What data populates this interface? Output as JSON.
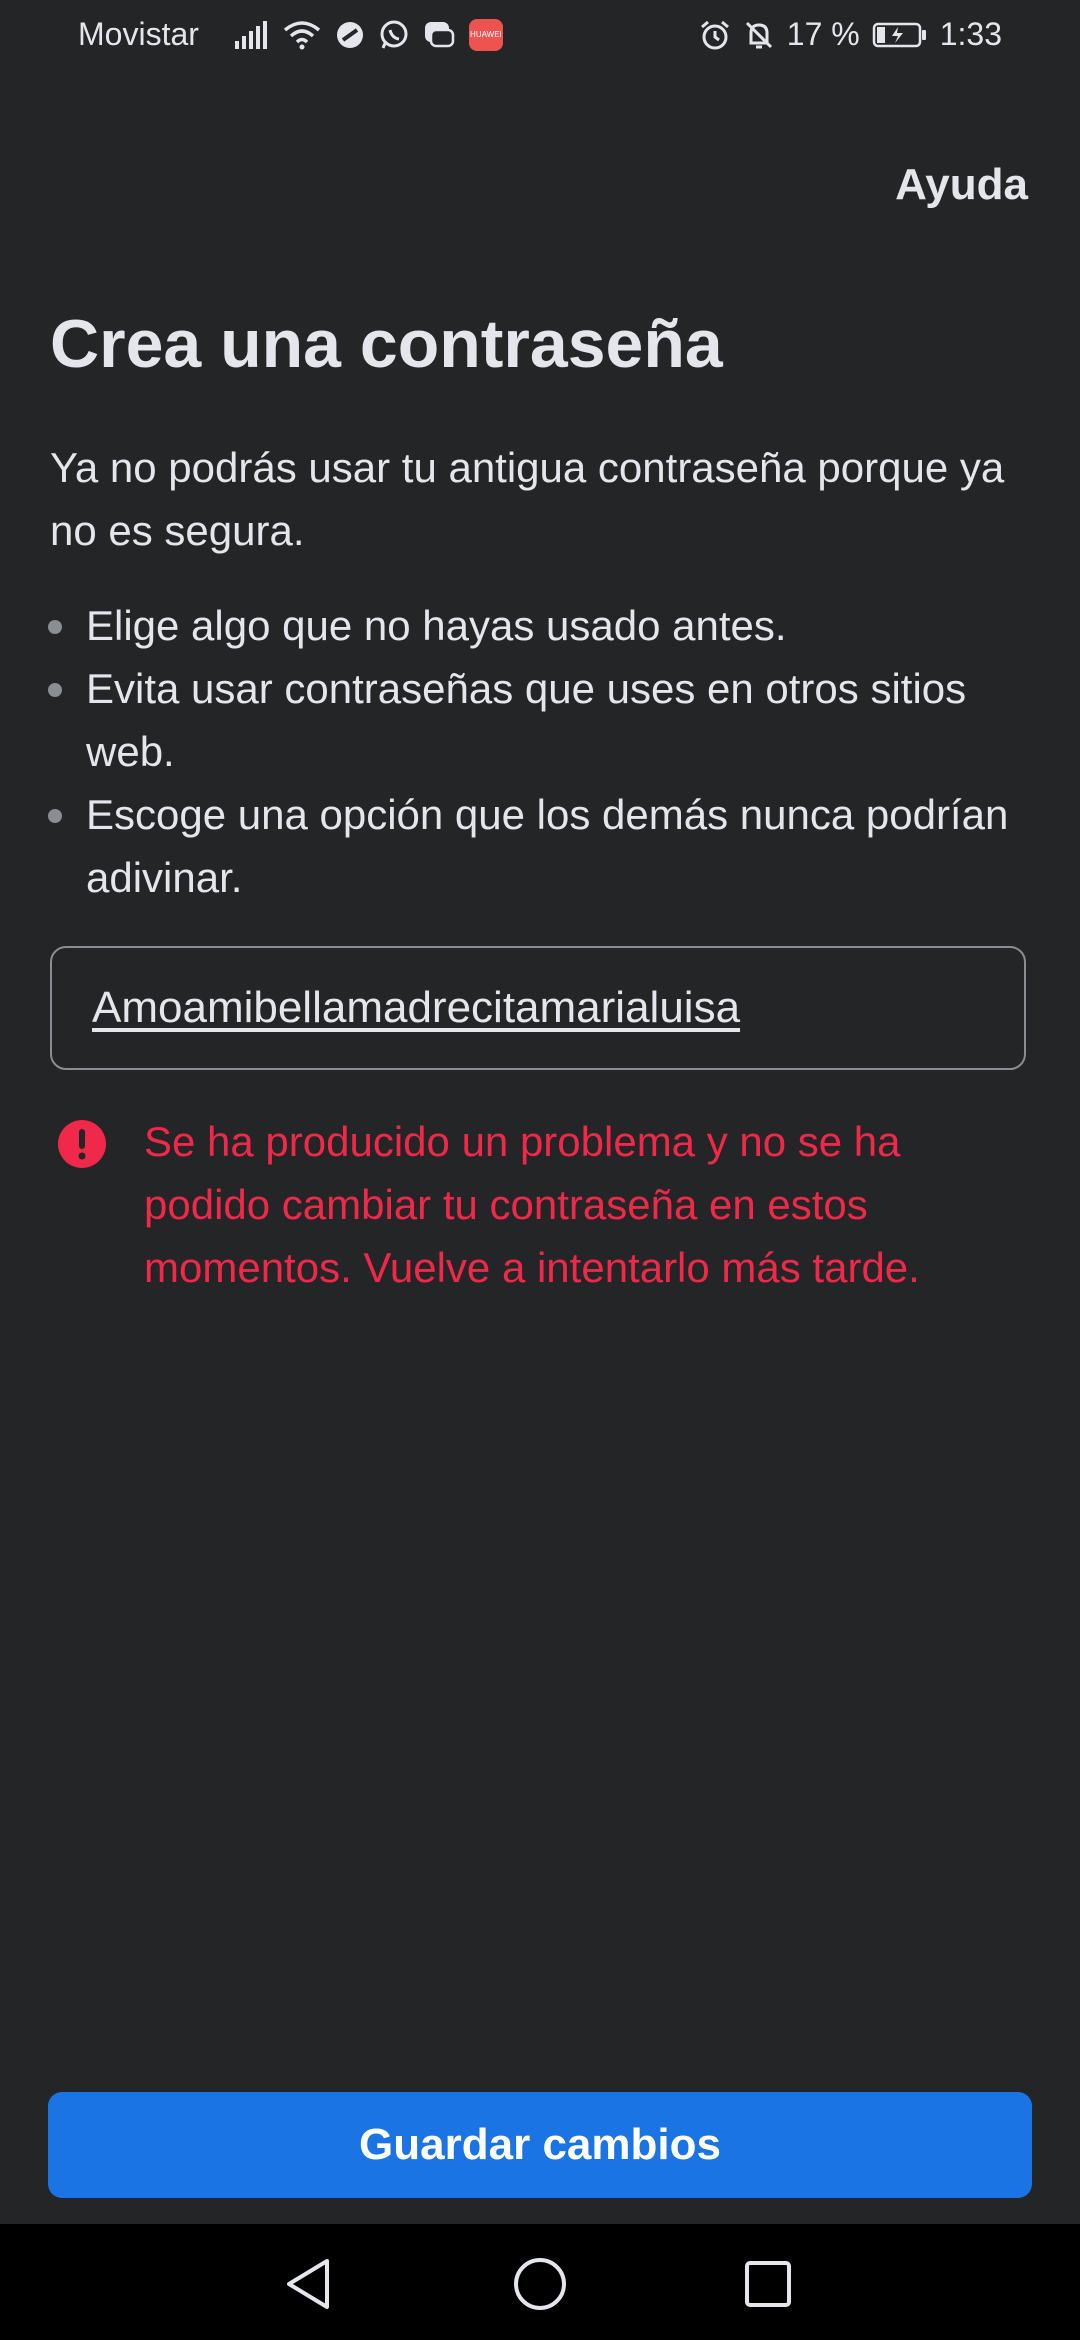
{
  "status_bar": {
    "carrier": "Movistar",
    "battery_percent": "17 %",
    "time": "1:33",
    "icons": [
      "signal-icon",
      "wifi-icon",
      "do-not-disturb-icon",
      "whatsapp-icon",
      "chat-icon",
      "huawei-app-icon",
      "alarm-icon",
      "bell-off-icon",
      "battery-charging-icon"
    ],
    "app_badge_label": "HUAWEI"
  },
  "header": {
    "help_label": "Ayuda"
  },
  "main": {
    "title": "Crea una contraseña",
    "intro": "Ya no podrás usar tu antigua contraseña porque ya no es segura.",
    "tips": [
      "Elige algo que no hayas usado antes.",
      "Evita usar contraseñas que uses en otros sitios web.",
      "Escoge una opción que los demás nunca podrían adivinar."
    ],
    "password_value": "Amoamibellamadrecitamarialuisa",
    "error_message": "Se ha producido un problema y no se ha podido cambiar tu contraseña en estos momentos. Vuelve a intentarlo más tarde."
  },
  "footer": {
    "save_label": "Guardar cambios"
  },
  "nav_bar": {
    "buttons": [
      "back-icon",
      "home-icon",
      "recents-icon"
    ]
  },
  "colors": {
    "background": "#242526",
    "text": "#e4e6eb",
    "error": "#f02849",
    "primary": "#1b74e4"
  }
}
